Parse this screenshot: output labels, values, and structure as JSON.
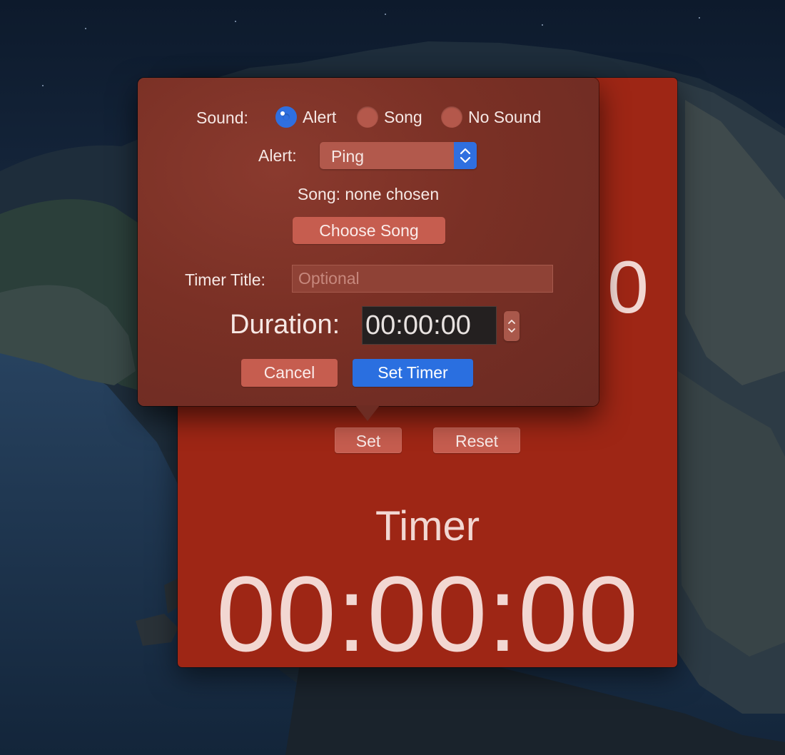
{
  "colors": {
    "window_red": "#9e2615",
    "popover_brown": "#7a3025",
    "accent_blue": "#2a6fe0",
    "button_red": "#c65d4f"
  },
  "timer_window": {
    "background_digits": "0",
    "set_button": "Set",
    "reset_button": "Reset",
    "timer_label": "Timer",
    "timer_display": "00:00:00"
  },
  "popover": {
    "sound_label": "Sound:",
    "sound_options": [
      {
        "label": "Alert",
        "selected": true
      },
      {
        "label": "Song",
        "selected": false
      },
      {
        "label": "No Sound",
        "selected": false
      }
    ],
    "alert_label": "Alert:",
    "alert_value": "Ping",
    "song_status": "Song: none chosen",
    "choose_song_button": "Choose Song",
    "timer_title_label": "Timer Title:",
    "timer_title_placeholder": "Optional",
    "timer_title_value": "",
    "duration_label": "Duration:",
    "duration_value": "00:00:00",
    "cancel_button": "Cancel",
    "set_timer_button": "Set Timer"
  },
  "icons": {
    "popup_arrows": "chevron-up-down-icon",
    "stepper": "stepper-arrows-icon",
    "radio_selected": "radio-selected-icon"
  }
}
